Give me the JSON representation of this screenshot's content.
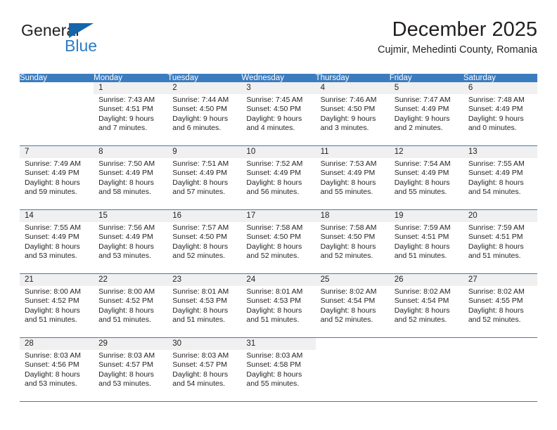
{
  "brand": {
    "name_top": "General",
    "name_bottom": "Blue",
    "triangle_icon": "triangle-icon",
    "color_dark": "#231f20",
    "color_blue": "#2b7cc4",
    "triangle_color": "#1366ab"
  },
  "header": {
    "title": "December 2025",
    "subtitle": "Cujmir, Mehedinti County, Romania"
  },
  "theme": {
    "header_bg": "#3b7cbf",
    "header_text": "#ffffff",
    "daynum_band_bg": "#f0f0f0",
    "grid_line": "#3b7cbf",
    "body_text": "#231f20"
  },
  "calendar": {
    "weekday_headers": [
      "Sunday",
      "Monday",
      "Tuesday",
      "Wednesday",
      "Thursday",
      "Friday",
      "Saturday"
    ],
    "weeks": [
      [
        {
          "day": "",
          "lines": []
        },
        {
          "day": "1",
          "lines": [
            "Sunrise: 7:43 AM",
            "Sunset: 4:51 PM",
            "Daylight: 9 hours",
            "and 7 minutes."
          ]
        },
        {
          "day": "2",
          "lines": [
            "Sunrise: 7:44 AM",
            "Sunset: 4:50 PM",
            "Daylight: 9 hours",
            "and 6 minutes."
          ]
        },
        {
          "day": "3",
          "lines": [
            "Sunrise: 7:45 AM",
            "Sunset: 4:50 PM",
            "Daylight: 9 hours",
            "and 4 minutes."
          ]
        },
        {
          "day": "4",
          "lines": [
            "Sunrise: 7:46 AM",
            "Sunset: 4:50 PM",
            "Daylight: 9 hours",
            "and 3 minutes."
          ]
        },
        {
          "day": "5",
          "lines": [
            "Sunrise: 7:47 AM",
            "Sunset: 4:49 PM",
            "Daylight: 9 hours",
            "and 2 minutes."
          ]
        },
        {
          "day": "6",
          "lines": [
            "Sunrise: 7:48 AM",
            "Sunset: 4:49 PM",
            "Daylight: 9 hours",
            "and 0 minutes."
          ]
        }
      ],
      [
        {
          "day": "7",
          "lines": [
            "Sunrise: 7:49 AM",
            "Sunset: 4:49 PM",
            "Daylight: 8 hours",
            "and 59 minutes."
          ]
        },
        {
          "day": "8",
          "lines": [
            "Sunrise: 7:50 AM",
            "Sunset: 4:49 PM",
            "Daylight: 8 hours",
            "and 58 minutes."
          ]
        },
        {
          "day": "9",
          "lines": [
            "Sunrise: 7:51 AM",
            "Sunset: 4:49 PM",
            "Daylight: 8 hours",
            "and 57 minutes."
          ]
        },
        {
          "day": "10",
          "lines": [
            "Sunrise: 7:52 AM",
            "Sunset: 4:49 PM",
            "Daylight: 8 hours",
            "and 56 minutes."
          ]
        },
        {
          "day": "11",
          "lines": [
            "Sunrise: 7:53 AM",
            "Sunset: 4:49 PM",
            "Daylight: 8 hours",
            "and 55 minutes."
          ]
        },
        {
          "day": "12",
          "lines": [
            "Sunrise: 7:54 AM",
            "Sunset: 4:49 PM",
            "Daylight: 8 hours",
            "and 55 minutes."
          ]
        },
        {
          "day": "13",
          "lines": [
            "Sunrise: 7:55 AM",
            "Sunset: 4:49 PM",
            "Daylight: 8 hours",
            "and 54 minutes."
          ]
        }
      ],
      [
        {
          "day": "14",
          "lines": [
            "Sunrise: 7:55 AM",
            "Sunset: 4:49 PM",
            "Daylight: 8 hours",
            "and 53 minutes."
          ]
        },
        {
          "day": "15",
          "lines": [
            "Sunrise: 7:56 AM",
            "Sunset: 4:49 PM",
            "Daylight: 8 hours",
            "and 53 minutes."
          ]
        },
        {
          "day": "16",
          "lines": [
            "Sunrise: 7:57 AM",
            "Sunset: 4:50 PM",
            "Daylight: 8 hours",
            "and 52 minutes."
          ]
        },
        {
          "day": "17",
          "lines": [
            "Sunrise: 7:58 AM",
            "Sunset: 4:50 PM",
            "Daylight: 8 hours",
            "and 52 minutes."
          ]
        },
        {
          "day": "18",
          "lines": [
            "Sunrise: 7:58 AM",
            "Sunset: 4:50 PM",
            "Daylight: 8 hours",
            "and 52 minutes."
          ]
        },
        {
          "day": "19",
          "lines": [
            "Sunrise: 7:59 AM",
            "Sunset: 4:51 PM",
            "Daylight: 8 hours",
            "and 51 minutes."
          ]
        },
        {
          "day": "20",
          "lines": [
            "Sunrise: 7:59 AM",
            "Sunset: 4:51 PM",
            "Daylight: 8 hours",
            "and 51 minutes."
          ]
        }
      ],
      [
        {
          "day": "21",
          "lines": [
            "Sunrise: 8:00 AM",
            "Sunset: 4:52 PM",
            "Daylight: 8 hours",
            "and 51 minutes."
          ]
        },
        {
          "day": "22",
          "lines": [
            "Sunrise: 8:00 AM",
            "Sunset: 4:52 PM",
            "Daylight: 8 hours",
            "and 51 minutes."
          ]
        },
        {
          "day": "23",
          "lines": [
            "Sunrise: 8:01 AM",
            "Sunset: 4:53 PM",
            "Daylight: 8 hours",
            "and 51 minutes."
          ]
        },
        {
          "day": "24",
          "lines": [
            "Sunrise: 8:01 AM",
            "Sunset: 4:53 PM",
            "Daylight: 8 hours",
            "and 51 minutes."
          ]
        },
        {
          "day": "25",
          "lines": [
            "Sunrise: 8:02 AM",
            "Sunset: 4:54 PM",
            "Daylight: 8 hours",
            "and 52 minutes."
          ]
        },
        {
          "day": "26",
          "lines": [
            "Sunrise: 8:02 AM",
            "Sunset: 4:54 PM",
            "Daylight: 8 hours",
            "and 52 minutes."
          ]
        },
        {
          "day": "27",
          "lines": [
            "Sunrise: 8:02 AM",
            "Sunset: 4:55 PM",
            "Daylight: 8 hours",
            "and 52 minutes."
          ]
        }
      ],
      [
        {
          "day": "28",
          "lines": [
            "Sunrise: 8:03 AM",
            "Sunset: 4:56 PM",
            "Daylight: 8 hours",
            "and 53 minutes."
          ]
        },
        {
          "day": "29",
          "lines": [
            "Sunrise: 8:03 AM",
            "Sunset: 4:57 PM",
            "Daylight: 8 hours",
            "and 53 minutes."
          ]
        },
        {
          "day": "30",
          "lines": [
            "Sunrise: 8:03 AM",
            "Sunset: 4:57 PM",
            "Daylight: 8 hours",
            "and 54 minutes."
          ]
        },
        {
          "day": "31",
          "lines": [
            "Sunrise: 8:03 AM",
            "Sunset: 4:58 PM",
            "Daylight: 8 hours",
            "and 55 minutes."
          ]
        },
        {
          "day": "",
          "lines": []
        },
        {
          "day": "",
          "lines": []
        },
        {
          "day": "",
          "lines": []
        }
      ]
    ]
  }
}
